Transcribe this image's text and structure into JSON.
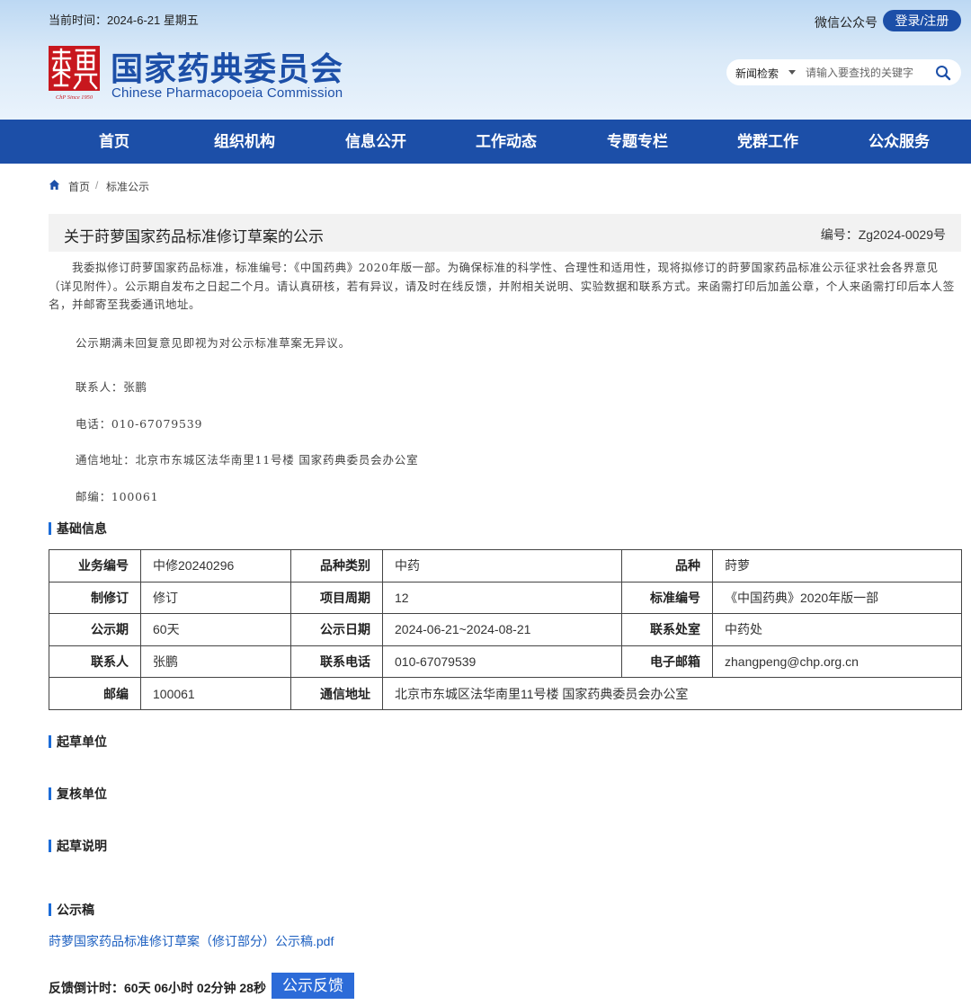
{
  "header": {
    "date_label": "当前时间：2024-6-21 星期五",
    "wechat": "微信公众号",
    "login": "登录/注册",
    "logo_cn": "国家药典委员会",
    "logo_en": "Chinese Pharmacopoeia Commission",
    "seal_text": "ChP Since 1950"
  },
  "search": {
    "category": "新闻检索",
    "placeholder": "请输入要查找的关键字"
  },
  "nav": {
    "items": [
      "首页",
      "组织机构",
      "信息公开",
      "工作动态",
      "专题专栏",
      "党群工作",
      "公众服务"
    ]
  },
  "breadcrumb": {
    "home": "首页",
    "separator": "/",
    "current": "标准公示"
  },
  "notice": {
    "title": "关于莳萝国家药品标准修订草案的公示",
    "number": "编号：Zg2024-0029号",
    "paragraph": "　　我委拟修订莳萝国家药品标准，标准编号：《中国药典》2020年版一部。为确保标准的科学性、合理性和适用性，现将拟修订的莳萝国家药品标准公示征求社会各界意见（详见附件）。公示期自发布之日起二个月。请认真研核，若有异议，请及时在线反馈，并附相关说明、实验数据和联系方式。来函需打印后加盖公章，个人来函需打印后本人签名，并邮寄至我委通讯地址。",
    "note": "公示期满未回复意见即视为对公示标准草案无异议。",
    "contact": "联系人：张鹏",
    "phone": "电话：010-67079539",
    "address": "通信地址：北京市东城区法华南里11号楼 国家药典委员会办公室",
    "postcode": "邮编：100061"
  },
  "sections": {
    "basic_info": "基础信息",
    "drafting_unit": "起草单位",
    "review_unit": "复核单位",
    "drafting_note": "起草说明",
    "publicity_draft": "公示稿"
  },
  "table": {
    "rows": [
      [
        "业务编号",
        "中修20240296",
        "品种类别",
        "中药",
        "品种",
        "莳萝"
      ],
      [
        "制修订",
        "修订",
        "项目周期",
        "12",
        "标准编号",
        "《中国药典》2020年版一部"
      ],
      [
        "公示期",
        "60天",
        "公示日期",
        "2024-06-21~2024-08-21",
        "联系处室",
        "中药处"
      ],
      [
        "联系人",
        "张鹏",
        "联系电话",
        "010-67079539",
        "电子邮箱",
        "zhangpeng@chp.org.cn"
      ],
      [
        "邮编",
        "100061",
        "通信地址",
        "北京市东城区法华南里11号楼 国家药典委员会办公室"
      ]
    ]
  },
  "attachment": {
    "link": "莳萝国家药品标准修订草案（修订部分）公示稿.pdf"
  },
  "feedback": {
    "countdown": "反馈倒计时：60天 06小时 02分钟 28秒",
    "button": "公示反馈"
  },
  "colors": {
    "brand": "#1c4fa8",
    "seal_red": "#c8171e",
    "link": "#1c5fc0",
    "section_marker": "#1c6cd8"
  }
}
